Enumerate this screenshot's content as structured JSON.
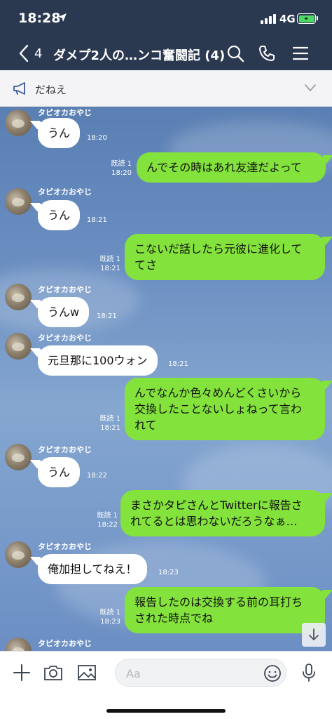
{
  "status": {
    "time": "18:28",
    "network": "4G"
  },
  "nav": {
    "back_count": "4",
    "title": "ダメプ2人の…ンコ奮闘記 (4)"
  },
  "notice": {
    "text": "だねえ"
  },
  "sender_name": "タピオカおやじ",
  "messages": [
    {
      "text": "うん",
      "time": "18:20"
    },
    {
      "read": "既読 1",
      "text": "んでその時はあれ友達だよって",
      "time": "18:20"
    },
    {
      "text": "うん",
      "time": "18:21"
    },
    {
      "read": "既読 1",
      "line1": "こないだ話したら元彼に進化して",
      "line2": "てさ",
      "time": "18:21"
    },
    {
      "text": "うんw",
      "time": "18:21"
    },
    {
      "text": "元旦那に100ウォン",
      "time": "18:21"
    },
    {
      "read": "既読 1",
      "line1": "んでなんか色々めんどくさいから",
      "line2": "交換したことないしょねって言わ",
      "line3": "れて",
      "time": "18:21"
    },
    {
      "text": "うん",
      "time": "18:22"
    },
    {
      "read": "既読 1",
      "line1": "まさかタピさんとTwitterに報告さ",
      "line2": "れてるとは思わないだろうなぁ…",
      "time": "18:22"
    },
    {
      "text": "俺加担してねえ！",
      "time": "18:23"
    },
    {
      "read": "既読 1",
      "line1": "報告したのは交換する前の耳打ち",
      "line2": "された時点でね",
      "time": "18:23"
    }
  ],
  "input": {
    "placeholder": "Aa"
  },
  "colors": {
    "header": "#2a3850",
    "bubble_out": "#84e23d",
    "bubble_in": "#ffffff",
    "chat_bg": "#6b8fc2"
  }
}
